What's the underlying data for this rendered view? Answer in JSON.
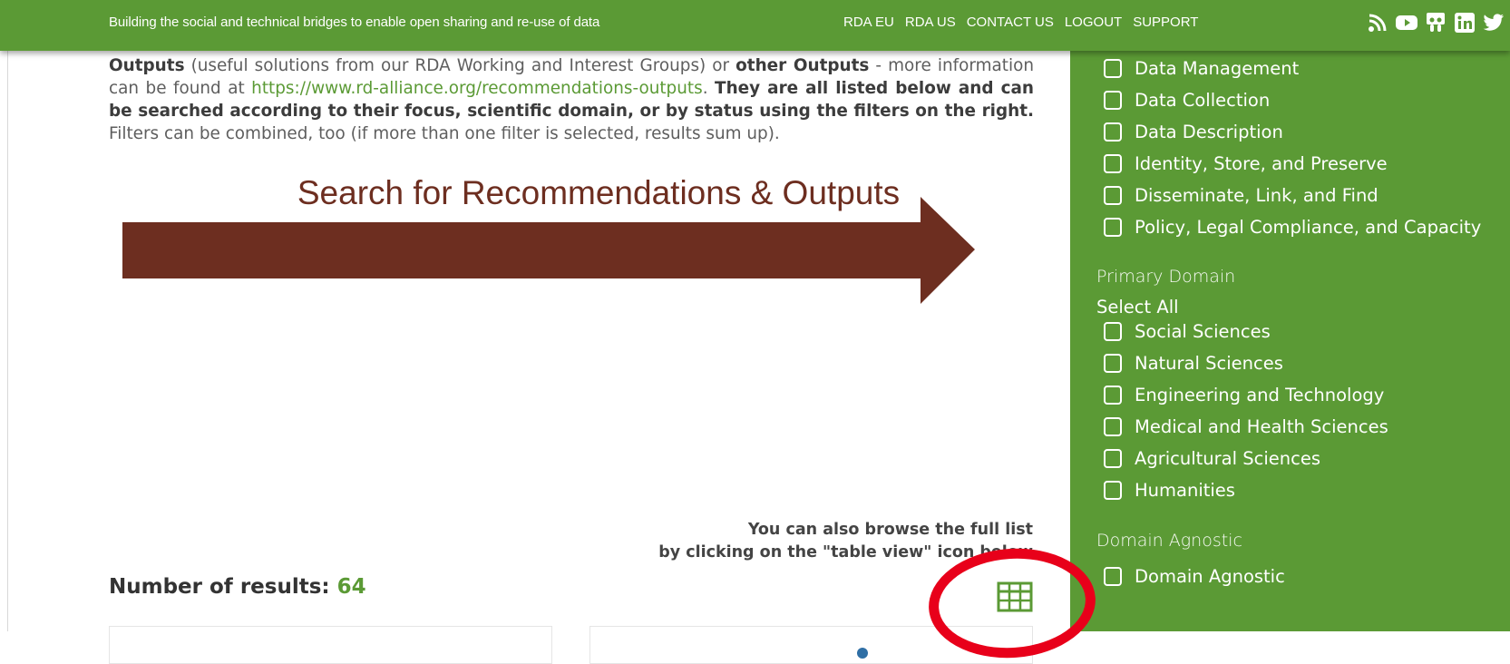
{
  "topbar": {
    "tagline": "Building the social and technical bridges to enable open sharing and re-use of data",
    "nav": [
      "RDA EU",
      "RDA US",
      "CONTACT US",
      "LOGOUT",
      "SUPPORT"
    ],
    "social_icons": [
      "rss-icon",
      "youtube-icon",
      "slideshare-icon",
      "linkedin-icon",
      "twitter-icon"
    ]
  },
  "intro": {
    "outputs_bold": "Outputs",
    "text1": " (useful solutions from our RDA Working and Interest Groups) or ",
    "other_outputs_bold": "other Outputs",
    "text2": " - more information can be found at ",
    "link": "https://www.rd-alliance.org/recommendations-outputs",
    "text3": ". ",
    "bold_sentence": "They are all listed below and can be searched according to their focus, scientific domain, or by status using the filters on the right.",
    "text4": " Filters can be combined, too (if more than one filter is selected, results sum up)."
  },
  "banner": {
    "text": "Search for Recommendations & Outputs",
    "color": "#6d2e20"
  },
  "browse": {
    "line1": "You can also browse the full list",
    "line2": "by clicking on the \"table view\" icon below"
  },
  "results": {
    "label": "Number of results: ",
    "count": "64"
  },
  "sidebar": {
    "focus_items": [
      "Data Management",
      "Data Collection",
      "Data Description",
      "Identity, Store, and Preserve",
      "Disseminate, Link, and Find",
      "Policy, Legal Compliance, and Capacity"
    ],
    "primary_domain": {
      "title": "Primary Domain",
      "select_all": "Select All",
      "items": [
        "Social Sciences",
        "Natural Sciences",
        "Engineering and Technology",
        "Medical and Health Sciences",
        "Agricultural Sciences",
        "Humanities"
      ]
    },
    "domain_agnostic": {
      "title": "Domain Agnostic",
      "items": [
        "Domain Agnostic"
      ]
    }
  },
  "colors": {
    "brand_green": "#5b9a35",
    "highlight_red": "#e8001a"
  }
}
